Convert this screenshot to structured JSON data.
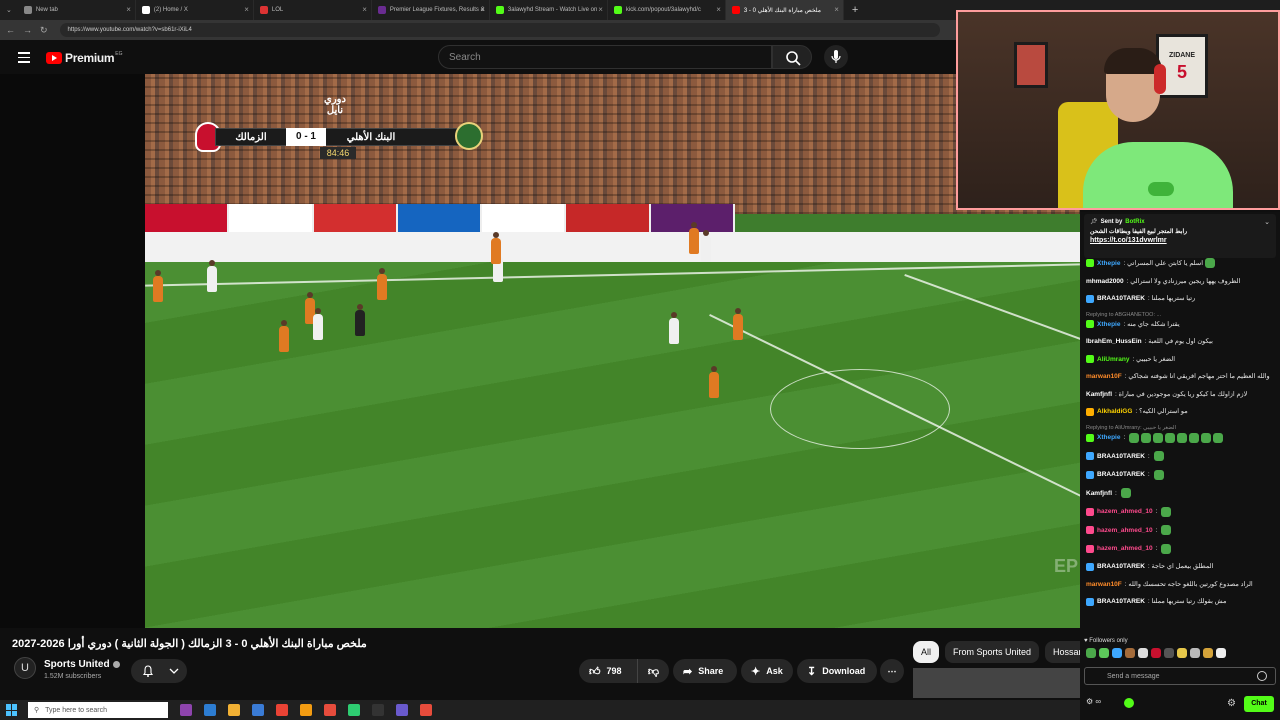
{
  "browser": {
    "tabs": [
      {
        "title": "New tab",
        "color": "#888"
      },
      {
        "title": "(2) Home / X",
        "color": "#fff"
      },
      {
        "title": "LOL",
        "color": "#d33"
      },
      {
        "title": "Premier League Fixtures, Results &",
        "color": "#6a2c91"
      },
      {
        "title": "3alawyhd Stream - Watch Live on",
        "color": "#53fc18"
      },
      {
        "title": "kick.com/popout/3alawyhd/c",
        "color": "#53fc18"
      },
      {
        "title": "ملخص مباراة البنك الأهلي 0 - 3",
        "color": "#ff0000",
        "active": true
      }
    ],
    "new_tab_icon": "+",
    "url": "https://www.youtube.com/watch?v=sb61r-iXiL4"
  },
  "youtube": {
    "logo_text": "Premium",
    "country_code": "EG",
    "search_placeholder": "Search",
    "video": {
      "scoreboard": {
        "brand": "دوري نايل",
        "team_left": "البنك الأهلي",
        "score": "0 - 1",
        "team_right": "الزمالك",
        "time": "84:46"
      },
      "watermark": "EP"
    },
    "title": "ملخص مباراة البنك الأهلي 0 - 3 الزمالك ( الجولة الثانية ) دوري أورا 2026-2027",
    "channel": {
      "name": "Sports United",
      "subscribers": "1.52M subscribers",
      "avatar_glyph": "U"
    },
    "actions": {
      "likes": "798",
      "share": "Share",
      "ask": "Ask",
      "download": "Download",
      "more": "⋯"
    },
    "chips": [
      "All",
      "From Sports United",
      "Hossam"
    ]
  },
  "taskbar": {
    "search_placeholder": "Type here to search",
    "icons": [
      "#8e44ad",
      "#2d7dd2",
      "#f2b134",
      "#3a7bd5",
      "#ea4335",
      "#f39c12",
      "#e74c3c",
      "#2ecc71",
      "#333",
      "#6a5acd",
      "#e74c3c"
    ]
  },
  "webcam": {
    "frame_label": "ZIDANE",
    "frame_number": "5"
  },
  "chat": {
    "pinned": {
      "sent_by_label": "Sent by",
      "sender": "BotRix",
      "text": "رابط المتجر لبيع الفيفا وبطاقات الشحن",
      "link": "https://t.co/131dvwrlmr"
    },
    "messages": [
      {
        "user": "Xthepie",
        "color": "#3ea8ff",
        "badge": "#53fc18",
        "text": "اسلم يا كابتن علي المسراتي",
        "emotes": 1
      },
      {
        "user": "mhmad2000",
        "color": "#ffffff",
        "badge": "",
        "text": "الظروف يهها ريجين ميرزنادي ولا استرالي",
        "emotes": 0
      },
      {
        "user": "BRAA10TAREK",
        "color": "#ffffff",
        "badge": "#3ea8ff",
        "text": "رتيا ستريها مملنا",
        "emotes": 0
      },
      {
        "reply": "Replying to ABGHANETOO: ...",
        "user": "Xthepie",
        "color": "#3ea8ff",
        "badge": "#53fc18",
        "text": "يقترا شكله جاي منه",
        "emotes": 0
      },
      {
        "user": "IbrahEm_HussEin",
        "color": "#ffffff",
        "badge": "",
        "text": "بيكون اول يوم في اللعبة",
        "emotes": 0
      },
      {
        "user": "AliUmrany",
        "color": "#53fc18",
        "badge": "#53fc18",
        "text": "الضغر يا حبيبي",
        "emotes": 0
      },
      {
        "user": "marwan10F",
        "color": "#ff8c2a",
        "badge": "",
        "text": "والله العظيم ما احتر مهاجم افريقي انا شوفته شجاكي",
        "emotes": 0
      },
      {
        "user": "Kamfjnfl",
        "color": "#ffffff",
        "badge": "",
        "text": "لازم ازاولك ما كيكو ريا يكون موجودين في مباراة",
        "emotes": 0
      },
      {
        "user": "AlkhaldiGG",
        "color": "#ffd400",
        "badge": "#ffae00",
        "text": "مو استرالي الكيه؟",
        "emotes": 0
      },
      {
        "reply": "Replying to AliUmrany: الضغر يا حبيبي",
        "user": "Xthepie",
        "color": "#3ea8ff",
        "badge": "#53fc18",
        "text": "",
        "emotes": 8
      },
      {
        "user": "BRAA10TAREK",
        "color": "#ffffff",
        "badge": "#3ea8ff",
        "text": "",
        "emotes": 1
      },
      {
        "user": "BRAA10TAREK",
        "color": "#ffffff",
        "badge": "#3ea8ff",
        "text": "",
        "emotes": 1
      },
      {
        "user": "Kamfjnfl",
        "color": "#ffffff",
        "badge": "",
        "text": "",
        "emotes": 1
      },
      {
        "user": "hazem_ahmed_10",
        "color": "#ff4a8d",
        "badge": "#ff4a8d",
        "text": "",
        "emotes": 1
      },
      {
        "user": "hazem_ahmed_10",
        "color": "#ff4a8d",
        "badge": "#ff4a8d",
        "text": "",
        "emotes": 1
      },
      {
        "user": "hazem_ahmed_10",
        "color": "#ff4a8d",
        "badge": "#ff4a8d",
        "text": "",
        "emotes": 1
      },
      {
        "user": "BRAA10TAREK",
        "color": "#ffffff",
        "badge": "#3ea8ff",
        "text": "المطلق بيعمل اي حاجة",
        "emotes": 0
      },
      {
        "user": "marwan10F",
        "color": "#ff8c2a",
        "badge": "",
        "text": "الراد مصدوع كورتين باللغو حاجه تحسسك والله",
        "emotes": 0
      },
      {
        "user": "BRAA10TAREK",
        "color": "#ffffff",
        "badge": "#3ea8ff",
        "text": "مش بقولك رتيا ستريها مملنا",
        "emotes": 0
      }
    ],
    "followers_only": "Followers only",
    "send_placeholder": "Send a message",
    "chat_button": "Chat"
  }
}
